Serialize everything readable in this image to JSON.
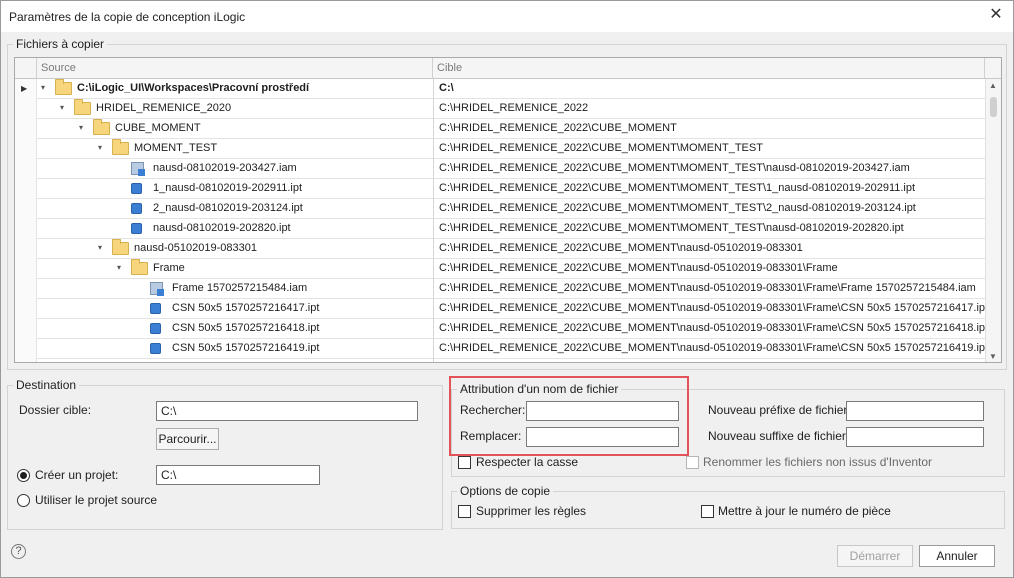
{
  "window": {
    "title": "Paramètres de la copie de conception iLogic",
    "close_glyph": "✕"
  },
  "files_group": {
    "label": "Fichiers à copier"
  },
  "grid": {
    "col_source": "Source",
    "col_target": "Cible",
    "rows": [
      {
        "indent": 0,
        "expander": "▾",
        "icon": "folder-icon",
        "name": "C:\\iLogic_UI\\Workspaces\\Pracovní prostředí",
        "target": "C:\\",
        "bold": true,
        "current": true
      },
      {
        "indent": 1,
        "expander": "▾",
        "icon": "folder-icon",
        "name": "HRIDEL_REMENICE_2020",
        "target": "C:\\HRIDEL_REMENICE_2022"
      },
      {
        "indent": 2,
        "expander": "▾",
        "icon": "folder-icon",
        "name": "CUBE_MOMENT",
        "target": "C:\\HRIDEL_REMENICE_2022\\CUBE_MOMENT"
      },
      {
        "indent": 3,
        "expander": "▾",
        "icon": "folder-icon",
        "name": "MOMENT_TEST",
        "target": "C:\\HRIDEL_REMENICE_2022\\CUBE_MOMENT\\MOMENT_TEST"
      },
      {
        "indent": 4,
        "expander": "",
        "icon": "assembly-icon",
        "name": "nausd-08102019-203427.iam",
        "target": "C:\\HRIDEL_REMENICE_2022\\CUBE_MOMENT\\MOMENT_TEST\\nausd-08102019-203427.iam"
      },
      {
        "indent": 4,
        "expander": "",
        "icon": "part-icon",
        "name": "1_nausd-08102019-202911.ipt",
        "target": "C:\\HRIDEL_REMENICE_2022\\CUBE_MOMENT\\MOMENT_TEST\\1_nausd-08102019-202911.ipt"
      },
      {
        "indent": 4,
        "expander": "",
        "icon": "part-icon",
        "name": "2_nausd-08102019-203124.ipt",
        "target": "C:\\HRIDEL_REMENICE_2022\\CUBE_MOMENT\\MOMENT_TEST\\2_nausd-08102019-203124.ipt"
      },
      {
        "indent": 4,
        "expander": "",
        "icon": "part-icon",
        "name": "nausd-08102019-202820.ipt",
        "target": "C:\\HRIDEL_REMENICE_2022\\CUBE_MOMENT\\MOMENT_TEST\\nausd-08102019-202820.ipt"
      },
      {
        "indent": 3,
        "expander": "▾",
        "icon": "folder-icon",
        "name": "nausd-05102019-083301",
        "target": "C:\\HRIDEL_REMENICE_2022\\CUBE_MOMENT\\nausd-05102019-083301"
      },
      {
        "indent": 4,
        "expander": "▾",
        "icon": "folder-icon",
        "name": "Frame",
        "target": "C:\\HRIDEL_REMENICE_2022\\CUBE_MOMENT\\nausd-05102019-083301\\Frame"
      },
      {
        "indent": 5,
        "expander": "",
        "icon": "assembly-icon",
        "name": "Frame 1570257215484.iam",
        "target": "C:\\HRIDEL_REMENICE_2022\\CUBE_MOMENT\\nausd-05102019-083301\\Frame\\Frame 1570257215484.iam"
      },
      {
        "indent": 5,
        "expander": "",
        "icon": "part-icon",
        "name": "CSN 50x5 1570257216417.ipt",
        "target": "C:\\HRIDEL_REMENICE_2022\\CUBE_MOMENT\\nausd-05102019-083301\\Frame\\CSN 50x5 1570257216417.ipt"
      },
      {
        "indent": 5,
        "expander": "",
        "icon": "part-icon",
        "name": "CSN 50x5 1570257216418.ipt",
        "target": "C:\\HRIDEL_REMENICE_2022\\CUBE_MOMENT\\nausd-05102019-083301\\Frame\\CSN 50x5 1570257216418.ipt"
      },
      {
        "indent": 5,
        "expander": "",
        "icon": "part-icon",
        "name": "CSN 50x5 1570257216419.ipt",
        "target": "C:\\HRIDEL_REMENICE_2022\\CUBE_MOMENT\\nausd-05102019-083301\\Frame\\CSN 50x5 1570257216419.ipt"
      },
      {
        "indent": 5,
        "expander": "",
        "icon": "part-icon",
        "name": "",
        "target": ""
      }
    ]
  },
  "destination": {
    "label": "Destination",
    "target_folder_label": "Dossier cible:",
    "target_folder_value": "C:\\",
    "browse_label": "Parcourir...",
    "create_project_label": "Créer un projet:",
    "create_project_value": "C:\\",
    "create_project_selected": true,
    "use_source_label": "Utiliser le projet source",
    "use_source_selected": false
  },
  "naming": {
    "label": "Attribution d'un nom de fichier",
    "search_label": "Rechercher:",
    "search_value": "",
    "replace_label": "Remplacer:",
    "replace_value": "",
    "prefix_label": "Nouveau préfixe de fichier:",
    "prefix_value": "",
    "suffix_label": "Nouveau suffixe de fichier:",
    "suffix_value": "",
    "match_case_label": "Respecter la casse",
    "rename_non_inventor_label": "Renommer les fichiers non issus d'Inventor"
  },
  "copy_options": {
    "label": "Options de copie",
    "suppress_rules_label": "Supprimer les règles",
    "update_part_number_label": "Mettre à jour le numéro de pièce"
  },
  "footer": {
    "start_label": "Démarrer",
    "cancel_label": "Annuler",
    "help_glyph": "?"
  },
  "colors": {
    "highlight": "#e3545a",
    "folder": "#f7d57c",
    "part": "#3b7fd4"
  }
}
